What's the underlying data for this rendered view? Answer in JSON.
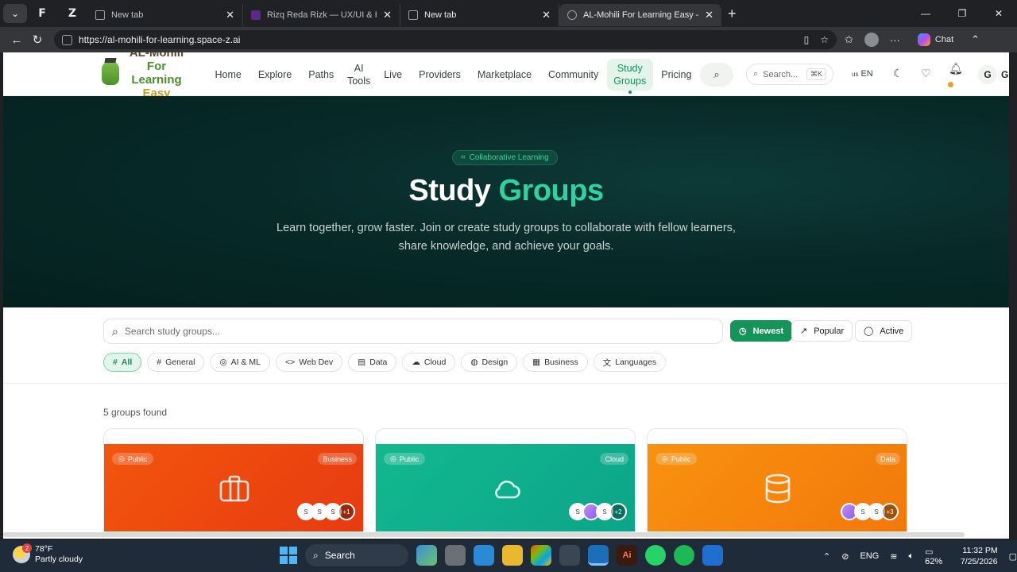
{
  "browser": {
    "tabs": [
      {
        "label": "New tab",
        "active": false
      },
      {
        "label": "Rizq Reda Rizk — UX/UI & Product",
        "active": false
      },
      {
        "label": "New tab",
        "active": false
      },
      {
        "label": "AL-Mohili For Learning Easy — Ent",
        "active": true
      }
    ],
    "url": "https://al-mohili-for-learning.space-z.ai",
    "chat_label": "Chat"
  },
  "site": {
    "logo": {
      "line1": "AL-Mohili",
      "line2": "For",
      "line3": "Learning",
      "line4": "Easy"
    },
    "nav": [
      {
        "id": "home",
        "label": "Home"
      },
      {
        "id": "explore",
        "label": "Explore"
      },
      {
        "id": "paths",
        "label": "Paths"
      },
      {
        "id": "ai-tools",
        "label": "AI Tools"
      },
      {
        "id": "live",
        "label": "Live"
      },
      {
        "id": "providers",
        "label": "Providers"
      },
      {
        "id": "marketplace",
        "label": "Marketplace"
      },
      {
        "id": "community",
        "label": "Community"
      },
      {
        "id": "study-groups",
        "label": "Study Groups",
        "active": true
      },
      {
        "id": "pricing",
        "label": "Pricing"
      }
    ],
    "search_placeholder": "Search...",
    "search_shortcut": "⌘K",
    "lang_flag": "us",
    "lang": "EN",
    "user_initial": "G"
  },
  "hero": {
    "badge": "Collaborative Learning",
    "title_main": "Study",
    "title_accent": "Groups",
    "subtitle": "Learn together, grow faster. Join or create study groups to collaborate with fellow learners, share knowledge, and achieve your goals."
  },
  "filters": {
    "search_placeholder": "Search study groups...",
    "sort": [
      {
        "label": "Newest",
        "active": true
      },
      {
        "label": "Popular",
        "active": false
      },
      {
        "label": "Active",
        "active": false
      }
    ],
    "categories": [
      {
        "label": "All",
        "icon": "#",
        "active": true
      },
      {
        "label": "General",
        "icon": "#"
      },
      {
        "label": "AI & ML",
        "icon": "◎"
      },
      {
        "label": "Web Dev",
        "icon": "<>"
      },
      {
        "label": "Data",
        "icon": "▤"
      },
      {
        "label": "Cloud",
        "icon": "☁"
      },
      {
        "label": "Design",
        "icon": "◍"
      },
      {
        "label": "Business",
        "icon": "▦"
      },
      {
        "label": "Languages",
        "icon": "文"
      }
    ]
  },
  "results": {
    "count_text": "5 groups found",
    "cards": [
      {
        "visibility": "Public",
        "category": "Business",
        "gradient": [
          "#f2560e",
          "#e83a10"
        ],
        "icon": "briefcase-icon",
        "members": [
          "S",
          "S",
          "S"
        ],
        "more": "+1"
      },
      {
        "visibility": "Public",
        "category": "Cloud",
        "gradient": [
          "#12b88e",
          "#0ca58a"
        ],
        "icon": "cloud-icon",
        "members": [
          "S",
          "",
          "S"
        ],
        "more": "+2"
      },
      {
        "visibility": "Public",
        "category": "Data",
        "gradient": [
          "#f8920e",
          "#f3780c"
        ],
        "icon": "database-icon",
        "members": [
          "",
          "S",
          "S"
        ],
        "more": "+3"
      }
    ]
  },
  "taskbar": {
    "weather_temp": "78°F",
    "weather_desc": "Partly cloudy",
    "weather_badge": "2",
    "search_label": "Search",
    "lang": "ENG",
    "battery": "62%",
    "time": "11:32 PM",
    "date": "7/25/2026"
  }
}
